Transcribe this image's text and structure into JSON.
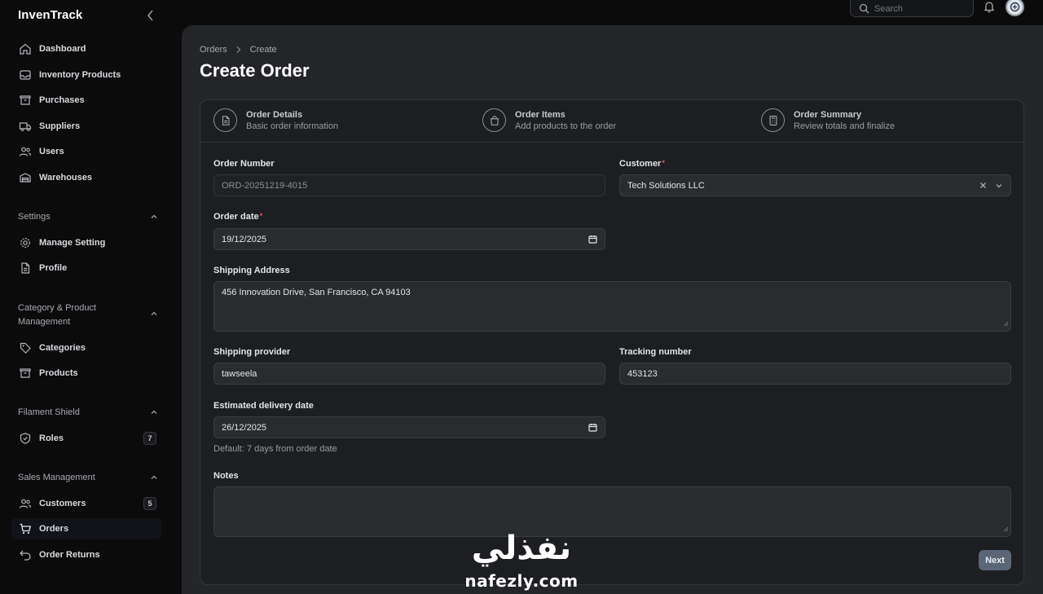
{
  "app": {
    "brand": "InvenTrack"
  },
  "sidebar": {
    "items": [
      {
        "label": "Dashboard",
        "icon": "home-icon"
      },
      {
        "label": "Inventory Products",
        "icon": "inbox-icon"
      },
      {
        "label": "Purchases",
        "icon": "archive-icon"
      },
      {
        "label": "Suppliers",
        "icon": "truck-icon"
      },
      {
        "label": "Users",
        "icon": "users-icon"
      },
      {
        "label": "Warehouses",
        "icon": "warehouse-icon"
      }
    ],
    "groups": {
      "settings": {
        "label": "Settings",
        "items": [
          {
            "label": "Manage Setting",
            "icon": "gear-icon"
          },
          {
            "label": "Profile",
            "icon": "document-icon"
          }
        ]
      },
      "category": {
        "label_line1": "Category & Product",
        "label_line2": "Management",
        "items": [
          {
            "label": "Categories",
            "icon": "tag-icon"
          },
          {
            "label": "Products",
            "icon": "archive-icon"
          }
        ]
      },
      "shield": {
        "label": "Filament Shield",
        "items": [
          {
            "label": "Roles",
            "icon": "shield-icon",
            "badge": "7"
          }
        ]
      },
      "sales": {
        "label": "Sales Management",
        "items": [
          {
            "label": "Customers",
            "icon": "users-icon",
            "badge": "5"
          },
          {
            "label": "Orders",
            "icon": "cart-icon",
            "active": true
          },
          {
            "label": "Order Returns",
            "icon": "return-icon"
          }
        ]
      }
    }
  },
  "topbar": {
    "search_placeholder": "Search"
  },
  "breadcrumb": {
    "parent": "Orders",
    "current": "Create"
  },
  "page": {
    "title": "Create Order"
  },
  "steps": [
    {
      "title": "Order Details",
      "subtitle": "Basic order information",
      "icon": "document-icon"
    },
    {
      "title": "Order Items",
      "subtitle": "Add products to the order",
      "icon": "shopping-bag-icon"
    },
    {
      "title": "Order Summary",
      "subtitle": "Review totals and finalize",
      "icon": "calculator-icon"
    }
  ],
  "form": {
    "order_number": {
      "label": "Order Number",
      "value": "ORD-20251219-4015"
    },
    "customer": {
      "label": "Customer",
      "required_mark": "*",
      "value": "Tech Solutions LLC"
    },
    "order_date": {
      "label": "Order date",
      "required_mark": "*",
      "value": "19/12/2025"
    },
    "shipping_address": {
      "label": "Shipping Address",
      "value": "456 Innovation Drive, San Francisco, CA 94103"
    },
    "shipping_provider": {
      "label": "Shipping provider",
      "value": "tawseela"
    },
    "tracking_number": {
      "label": "Tracking number",
      "value": "453123"
    },
    "estimated_delivery": {
      "label": "Estimated delivery date",
      "value": "26/12/2025",
      "hint": "Default: 7 days from order date"
    },
    "notes": {
      "label": "Notes",
      "value": ""
    }
  },
  "actions": {
    "next": "Next"
  },
  "watermark": {
    "arabic": "نفذلي",
    "latin": "nafezly.com"
  },
  "colors": {
    "background": "#0b0b0c",
    "panel": "#242528",
    "card": "#1d1e21",
    "next_button": "#5b6578",
    "required": "#e05a5a"
  }
}
